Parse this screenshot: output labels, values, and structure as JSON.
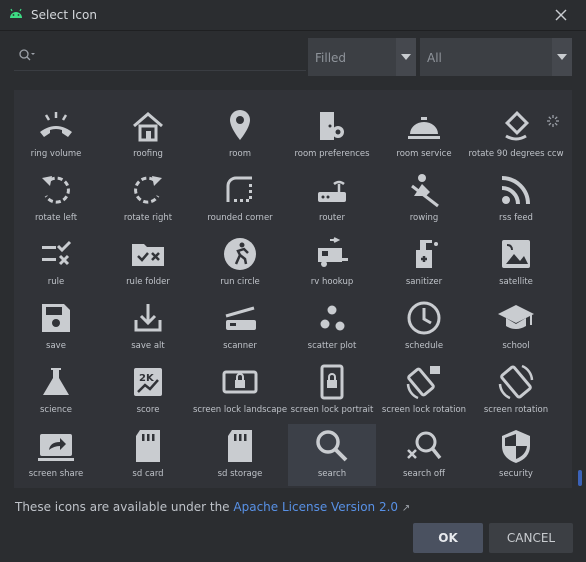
{
  "window": {
    "title": "Select Icon"
  },
  "search": {
    "placeholder": ""
  },
  "filters": {
    "style": "Filled",
    "category": "All"
  },
  "icons": [
    [
      "ring volume",
      "roofing",
      "room",
      "room preferences",
      "room service",
      "rotate 90 degrees ccw"
    ],
    [
      "rotate left",
      "rotate right",
      "rounded corner",
      "router",
      "rowing",
      "rss feed"
    ],
    [
      "rule",
      "rule folder",
      "run circle",
      "rv hookup",
      "sanitizer",
      "satellite"
    ],
    [
      "save",
      "save alt",
      "scanner",
      "scatter plot",
      "schedule",
      "school"
    ],
    [
      "science",
      "score",
      "screen lock landscape",
      "screen lock portrait",
      "screen lock rotation",
      "screen rotation"
    ],
    [
      "screen share",
      "sd card",
      "sd storage",
      "search",
      "search off",
      "security"
    ]
  ],
  "selected": "search",
  "footer": {
    "text": "These icons are available under the ",
    "link": "Apache License Version 2.0",
    "ext": "↗"
  },
  "buttons": {
    "ok": "OK",
    "cancel": "CANCEL"
  },
  "colors": {
    "accent": "#5891e6",
    "icon": "#c9ccd0",
    "android": "#3ddc84"
  }
}
